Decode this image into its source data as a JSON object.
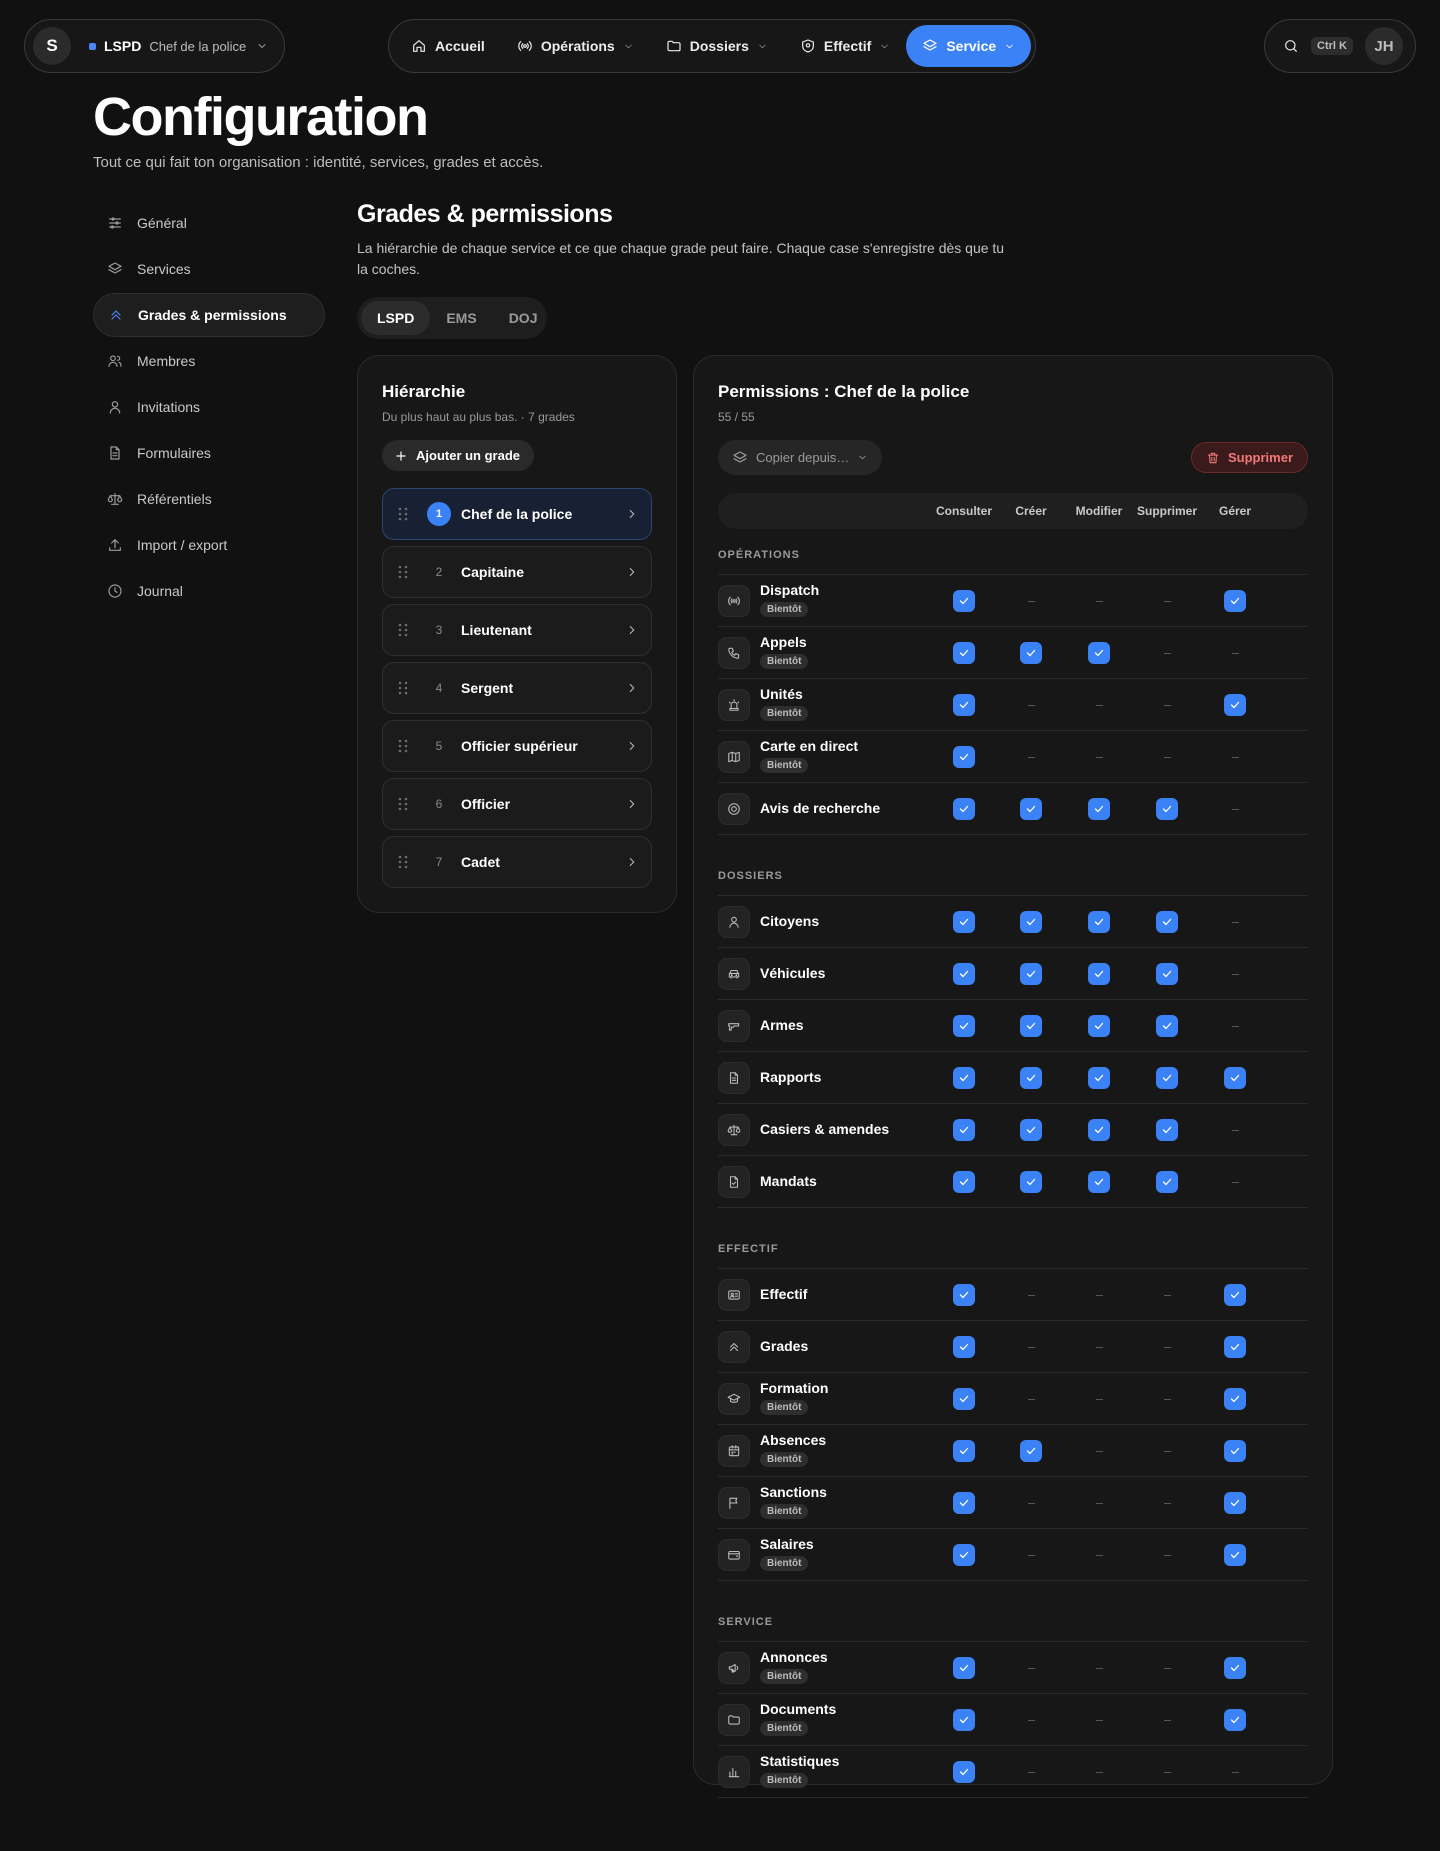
{
  "topbar": {
    "org_initial": "S",
    "org_code": "LSPD",
    "org_role": "Chef de la police",
    "nav": [
      {
        "label": "Accueil",
        "icon": "home-icon",
        "chevron": false,
        "active": false
      },
      {
        "label": "Opérations",
        "icon": "broadcast-icon",
        "chevron": true,
        "active": false
      },
      {
        "label": "Dossiers",
        "icon": "folder-icon",
        "chevron": true,
        "active": false
      },
      {
        "label": "Effectif",
        "icon": "shield-icon",
        "chevron": true,
        "active": false
      },
      {
        "label": "Service",
        "icon": "layers-icon",
        "chevron": true,
        "active": true
      }
    ],
    "shortcut": "Ctrl K",
    "user_initials": "JH"
  },
  "page": {
    "title": "Configuration",
    "subtitle": "Tout ce qui fait ton organisation : identité, services, grades et accès."
  },
  "sidebar": {
    "items": [
      {
        "label": "Général",
        "icon": "sliders-icon",
        "active": false
      },
      {
        "label": "Services",
        "icon": "layers-icon",
        "active": false
      },
      {
        "label": "Grades & permissions",
        "icon": "chevrons-up-icon",
        "active": true
      },
      {
        "label": "Membres",
        "icon": "users-icon",
        "active": false
      },
      {
        "label": "Invitations",
        "icon": "user-icon",
        "active": false
      },
      {
        "label": "Formulaires",
        "icon": "file-icon",
        "active": false
      },
      {
        "label": "Référentiels",
        "icon": "scale-icon",
        "active": false
      },
      {
        "label": "Import / export",
        "icon": "upload-icon",
        "active": false
      },
      {
        "label": "Journal",
        "icon": "clock-icon",
        "active": false
      }
    ]
  },
  "section": {
    "title": "Grades & permissions",
    "description": "La hiérarchie de chaque service et ce que chaque grade peut faire. Chaque case s'enregistre dès que tu la coches.",
    "tabs": [
      {
        "label": "LSPD",
        "active": true
      },
      {
        "label": "EMS",
        "active": false
      },
      {
        "label": "DOJ",
        "active": false
      }
    ]
  },
  "hierarchy": {
    "title": "Hiérarchie",
    "subtitle": "Du plus haut au plus bas. · 7 grades",
    "add_label": "Ajouter un grade",
    "grades": [
      {
        "num": "1",
        "name": "Chef de la police",
        "active": true
      },
      {
        "num": "2",
        "name": "Capitaine",
        "active": false
      },
      {
        "num": "3",
        "name": "Lieutenant",
        "active": false
      },
      {
        "num": "4",
        "name": "Sergent",
        "active": false
      },
      {
        "num": "5",
        "name": "Officier supérieur",
        "active": false
      },
      {
        "num": "6",
        "name": "Officier",
        "active": false
      },
      {
        "num": "7",
        "name": "Cadet",
        "active": false
      }
    ]
  },
  "permissions": {
    "title": "Permissions : Chef de la police",
    "count": "55 / 55",
    "copy_label": "Copier depuis…",
    "delete_label": "Supprimer",
    "columns": [
      "Consulter",
      "Créer",
      "Modifier",
      "Supprimer",
      "Gérer"
    ],
    "badge_label": "Bientôt",
    "groups": [
      {
        "title": "OPÉRATIONS",
        "rows": [
          {
            "name": "Dispatch",
            "icon": "broadcast-icon",
            "badge": true,
            "checks": [
              1,
              0,
              0,
              0,
              1
            ]
          },
          {
            "name": "Appels",
            "icon": "phone-icon",
            "badge": true,
            "checks": [
              1,
              1,
              1,
              0,
              0
            ]
          },
          {
            "name": "Unités",
            "icon": "siren-icon",
            "badge": true,
            "checks": [
              1,
              0,
              0,
              0,
              1
            ]
          },
          {
            "name": "Carte en direct",
            "icon": "map-icon",
            "badge": true,
            "checks": [
              1,
              0,
              0,
              0,
              0
            ]
          },
          {
            "name": "Avis de recherche",
            "icon": "target-icon",
            "badge": false,
            "checks": [
              1,
              1,
              1,
              1,
              0
            ]
          }
        ]
      },
      {
        "title": "DOSSIERS",
        "rows": [
          {
            "name": "Citoyens",
            "icon": "user-icon",
            "badge": false,
            "checks": [
              1,
              1,
              1,
              1,
              0
            ]
          },
          {
            "name": "Véhicules",
            "icon": "car-icon",
            "badge": false,
            "checks": [
              1,
              1,
              1,
              1,
              0
            ]
          },
          {
            "name": "Armes",
            "icon": "gun-icon",
            "badge": false,
            "checks": [
              1,
              1,
              1,
              1,
              0
            ]
          },
          {
            "name": "Rapports",
            "icon": "file-icon",
            "badge": false,
            "checks": [
              1,
              1,
              1,
              1,
              1
            ]
          },
          {
            "name": "Casiers & amendes",
            "icon": "scale-icon",
            "badge": false,
            "checks": [
              1,
              1,
              1,
              1,
              0
            ]
          },
          {
            "name": "Mandats",
            "icon": "file-check-icon",
            "badge": false,
            "checks": [
              1,
              1,
              1,
              1,
              0
            ]
          }
        ]
      },
      {
        "title": "EFFECTIF",
        "rows": [
          {
            "name": "Effectif",
            "icon": "id-card-icon",
            "badge": false,
            "checks": [
              1,
              0,
              0,
              0,
              1
            ]
          },
          {
            "name": "Grades",
            "icon": "chevrons-up-icon",
            "badge": false,
            "checks": [
              1,
              0,
              0,
              0,
              1
            ]
          },
          {
            "name": "Formation",
            "icon": "graduation-icon",
            "badge": true,
            "checks": [
              1,
              0,
              0,
              0,
              1
            ]
          },
          {
            "name": "Absences",
            "icon": "calendar-icon",
            "badge": true,
            "checks": [
              1,
              1,
              0,
              0,
              1
            ]
          },
          {
            "name": "Sanctions",
            "icon": "flag-icon",
            "badge": true,
            "checks": [
              1,
              0,
              0,
              0,
              1
            ]
          },
          {
            "name": "Salaires",
            "icon": "wallet-icon",
            "badge": true,
            "checks": [
              1,
              0,
              0,
              0,
              1
            ]
          }
        ]
      },
      {
        "title": "SERVICE",
        "rows": [
          {
            "name": "Annonces",
            "icon": "megaphone-icon",
            "badge": true,
            "checks": [
              1,
              0,
              0,
              0,
              1
            ]
          },
          {
            "name": "Documents",
            "icon": "folder-icon",
            "badge": true,
            "checks": [
              1,
              0,
              0,
              0,
              1
            ]
          },
          {
            "name": "Statistiques",
            "icon": "bar-chart-icon",
            "badge": true,
            "checks": [
              1,
              0,
              0,
              0,
              0
            ]
          }
        ]
      }
    ]
  }
}
